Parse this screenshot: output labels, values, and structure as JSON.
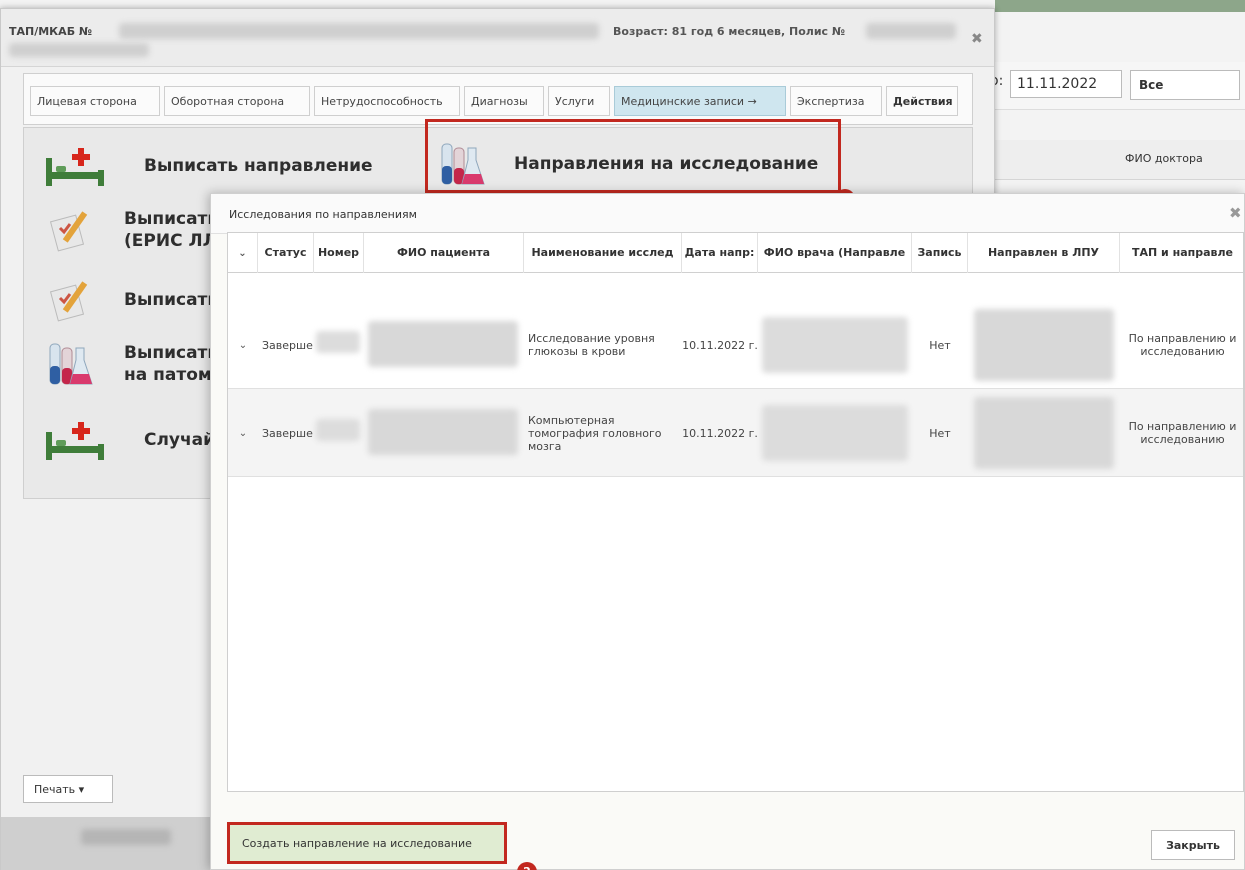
{
  "background": {
    "date_prefix": "о:",
    "date_value": "11.11.2022",
    "filter_select": "Все",
    "column_doctor": "ФИО доктора"
  },
  "tap_window": {
    "title": "ТАП/МКАБ №",
    "age_policy": "Возраст: 81 год 6 месяцев, Полис №",
    "tabs": [
      {
        "label": "Лицевая сторона"
      },
      {
        "label": "Оборотная сторона"
      },
      {
        "label": "Нетрудоспособность"
      },
      {
        "label": "Диагнозы"
      },
      {
        "label": "Услуги"
      },
      {
        "label": "Медицинские записи →"
      },
      {
        "label": "Экспертиза"
      },
      {
        "label": "Действия"
      }
    ],
    "actions": [
      {
        "label": "Выписать направление",
        "icon": "bed-plus-icon"
      },
      {
        "label": "Направления на исследование",
        "icon": "lab-flasks-icon"
      },
      {
        "label": "Выписать (ЕРИС ЛЛ",
        "icon": "pencil-form-icon"
      },
      {
        "label": "Выписать",
        "icon": "pencil-form-icon"
      },
      {
        "label": "Выписать на патом",
        "icon": "lab-flasks-icon"
      },
      {
        "label": "Случай л",
        "icon": "bed-plus-icon"
      }
    ],
    "print_label": "Печать ▾",
    "markers": {
      "first": "1",
      "second": "2"
    }
  },
  "dialog": {
    "title": "Исследования по направлениям",
    "columns": [
      "",
      "Статус",
      "Номер",
      "ФИО пациента",
      "Наименование исслед",
      "Дата напр:",
      "ФИО врача (Направле",
      "Запись",
      "Направлен в ЛПУ",
      "ТАП и направле"
    ],
    "rows": [
      {
        "status": "Заверше",
        "name": "Исследование уровня глюкозы в крови",
        "date": "10.11.2022 г.",
        "record": "Нет",
        "tap": "По направлению и исследованию"
      },
      {
        "status": "Заверше",
        "name": "Компьютерная томография головного мозга",
        "date": "10.11.2022 г.",
        "record": "Нет",
        "tap": "По направлению и исследованию"
      }
    ],
    "create_label": "Создать направление на исследование",
    "close_label": "Закрыть"
  },
  "colors": {
    "highlight": "#c2281f",
    "active_tab": "#cfe6ef",
    "create_button": "#e0ecd2"
  }
}
